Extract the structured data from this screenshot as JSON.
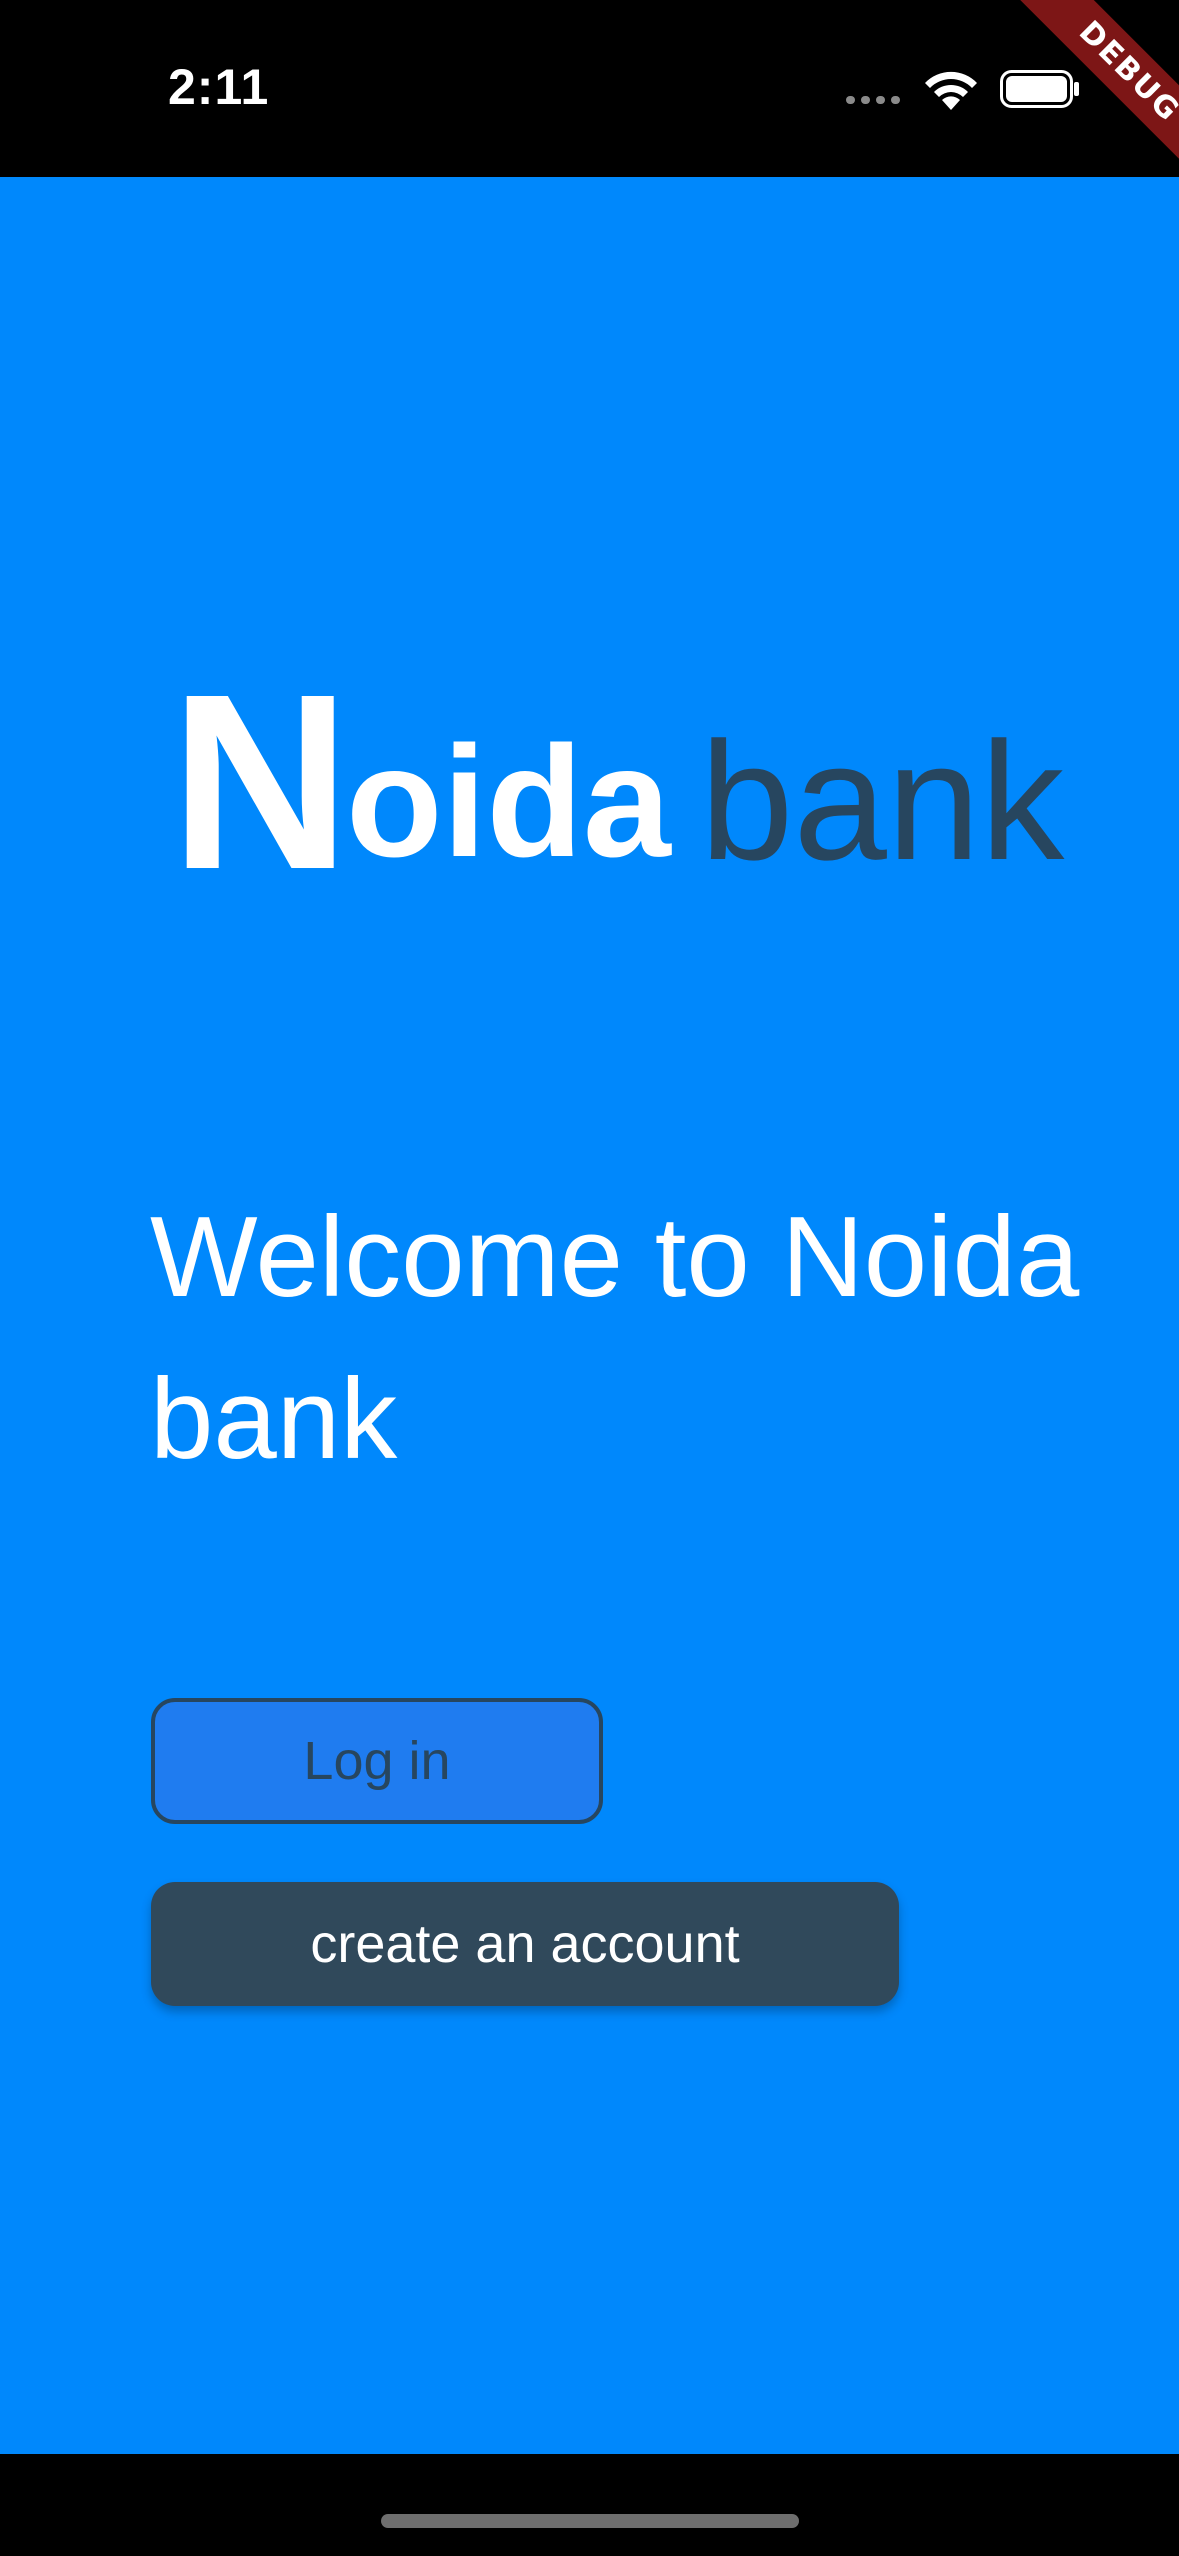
{
  "status_bar": {
    "time": "2:11"
  },
  "debug_banner": {
    "label": "DEBUG"
  },
  "logo": {
    "initial": "N",
    "rest": "oida",
    "suffix": "bank"
  },
  "welcome": {
    "text": "Welcome to Noida bank"
  },
  "buttons": {
    "login_label": "Log in",
    "create_account_label": "create an account"
  },
  "colors": {
    "background": "#0088fc",
    "logo_accent": "#27465f",
    "primary_button": "#30495b",
    "debug_ribbon": "#7d1616"
  },
  "icons": {
    "signal": "signal-dots-icon",
    "wifi": "wifi-icon",
    "battery": "battery-icon"
  }
}
